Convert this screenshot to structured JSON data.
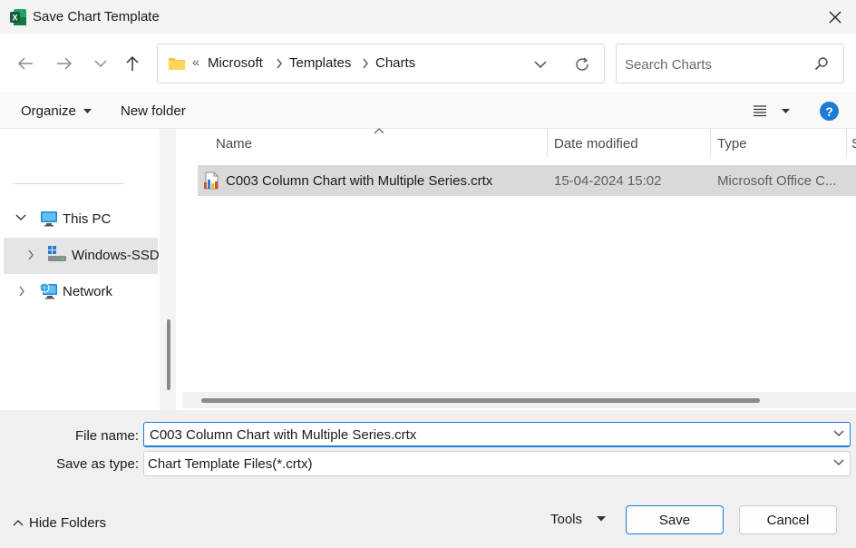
{
  "window": {
    "title": "Save Chart Template"
  },
  "address": {
    "overflow": "«",
    "crumbs": [
      "Microsoft",
      "Templates",
      "Charts"
    ]
  },
  "search": {
    "placeholder": "Search Charts"
  },
  "toolbar": {
    "organize": "Organize",
    "new_folder": "New folder",
    "help": "?"
  },
  "nav": {
    "items": [
      {
        "label": "This PC"
      },
      {
        "label": "Windows-SSD"
      },
      {
        "label": "Network"
      }
    ]
  },
  "files": {
    "columns": [
      "Name",
      "Date modified",
      "Type",
      "S"
    ],
    "rows": [
      {
        "name": "C003 Column Chart with Multiple Series.crtx",
        "date": "15-04-2024 15:02",
        "type": "Microsoft Office C..."
      }
    ]
  },
  "form": {
    "file_name_label": "File name:",
    "file_name_value": "C003 Column Chart with Multiple Series.crtx",
    "save_type_label": "Save as type:",
    "save_type_value": "Chart Template Files(*.crtx)"
  },
  "footer": {
    "hide_folders": "Hide Folders",
    "tools": "Tools",
    "save": "Save",
    "cancel": "Cancel"
  },
  "colors": {
    "accent": "#1e7bd4",
    "excel_green": "#1d6f42",
    "selection": "#d9d9d9"
  }
}
